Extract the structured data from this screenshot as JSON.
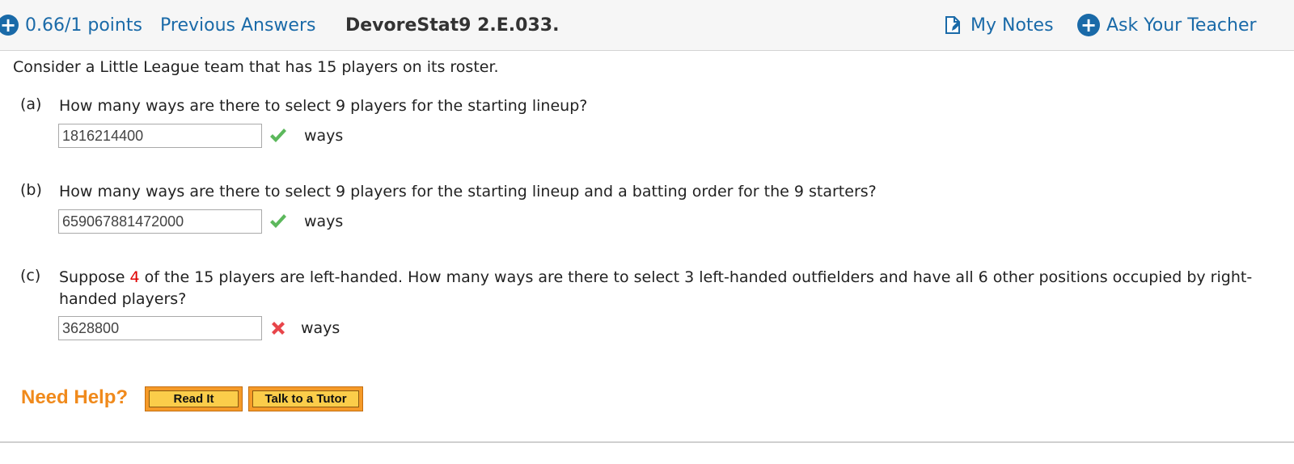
{
  "header": {
    "score": "0.66/1 points",
    "previous_answers": "Previous Answers",
    "problem_id": "DevoreStat9 2.E.033.",
    "my_notes": "My Notes",
    "ask_teacher": "Ask Your Teacher"
  },
  "intro": "Consider a Little League team that has 15 players on its roster.",
  "parts": [
    {
      "letter": "(a)",
      "question": "How many ways are there to select 9 players for the starting lineup?",
      "answer": "1816214400",
      "status": "correct",
      "unit": "ways"
    },
    {
      "letter": "(b)",
      "question": "How many ways are there to select 9 players for the starting lineup and a batting order for the 9 starters?",
      "answer": "659067881472000",
      "status": "correct",
      "unit": "ways"
    },
    {
      "letter": "(c)",
      "question_before": "Suppose ",
      "question_highlight": "4",
      "question_after": " of the 15 players are left-handed. How many ways are there to select 3 left-handed outfielders and have all 6 other positions occupied by right-handed players?",
      "answer": "3628800",
      "status": "incorrect",
      "unit": "ways"
    }
  ],
  "help": {
    "label": "Need Help?",
    "read_it": "Read It",
    "talk_tutor": "Talk to a Tutor"
  },
  "colors": {
    "link": "#1a6aa8",
    "highlight_red": "#e00000",
    "correct_green": "#5cb85c",
    "incorrect_red": "#e8454a",
    "need_help_orange": "#f08a1c"
  }
}
